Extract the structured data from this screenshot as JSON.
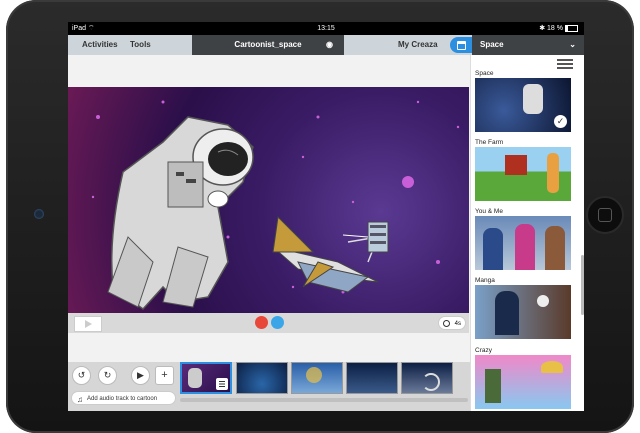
{
  "status_bar": {
    "device": "iPad",
    "time": "13:15",
    "battery": "18 %"
  },
  "nav": {
    "activities": "Activities",
    "tools": "Tools",
    "title": "Cartoonist_space",
    "my_creaza": "My Creaza",
    "dropdown_value": "Space"
  },
  "timer": {
    "duration": "4s"
  },
  "audio": {
    "label": "Add audio track to cartoon"
  },
  "panel": {
    "categories": [
      {
        "label": "Space",
        "selected": true
      },
      {
        "label": "The Farm",
        "selected": false
      },
      {
        "label": "You & Me",
        "selected": false
      },
      {
        "label": "Manga",
        "selected": false
      },
      {
        "label": "Crazy",
        "selected": false
      }
    ]
  },
  "colors": {
    "accent": "#2d8fe0",
    "dark_bar": "#3f4245",
    "nav_bg": "#cdd5da",
    "record": "#e8483a"
  }
}
